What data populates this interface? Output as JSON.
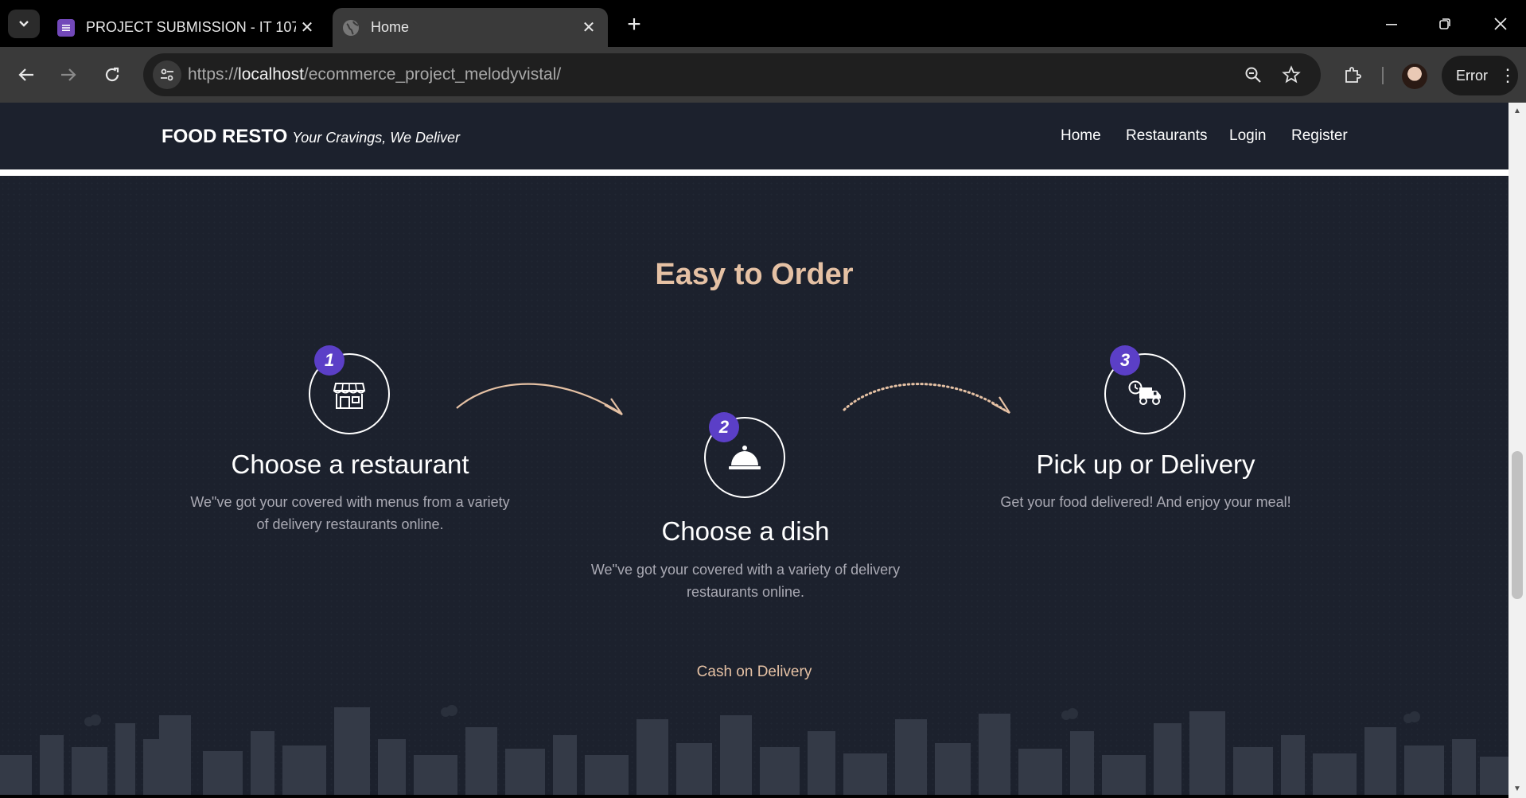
{
  "browser": {
    "tabs": [
      {
        "label": "PROJECT SUBMISSION - IT 107",
        "active": false,
        "icon": "forms-icon"
      },
      {
        "label": "Home",
        "active": true,
        "icon": "globe-icon"
      }
    ],
    "url": {
      "scheme": "https://",
      "host": "localhost",
      "path": "/ecommerce_project_melodyvistal/"
    },
    "profile_button_label": "Error"
  },
  "site": {
    "brand": "FOOD RESTO",
    "tagline": "Your Cravings, We Deliver",
    "nav": [
      "Home",
      "Restaurants",
      "Login",
      "Register"
    ]
  },
  "section": {
    "title": "Easy to Order",
    "steps": [
      {
        "number": "1",
        "icon": "storefront-icon",
        "title": "Choose a restaurant",
        "desc": "We\"ve got your covered with menus from a variety of delivery restaurants online."
      },
      {
        "number": "2",
        "icon": "cloche-icon",
        "title": "Choose a dish",
        "desc": "We\"ve got your covered with a variety of delivery restaurants online."
      },
      {
        "number": "3",
        "icon": "delivery-truck-icon",
        "title": "Pick up or Delivery",
        "desc": "Get your food delivered! And enjoy your meal!"
      }
    ],
    "payment_note": "Cash on Delivery"
  },
  "colors": {
    "page_bg": "#1c212d",
    "accent": "#e5c1a4",
    "badge": "#5b3fc7"
  }
}
